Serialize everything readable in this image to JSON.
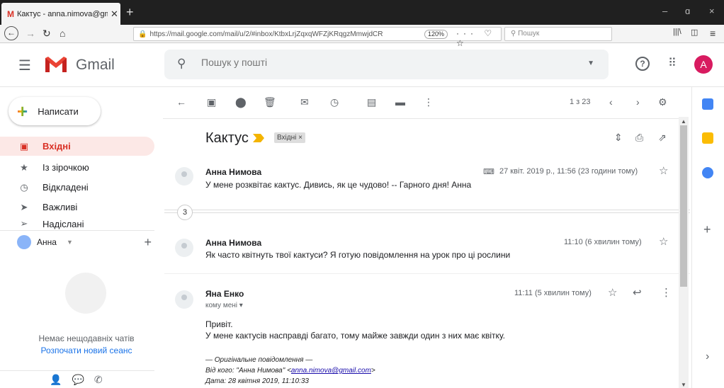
{
  "browser": {
    "tab_title": "Кактус - anna.nimova@gmail.",
    "tab_close": "✕",
    "new_tab": "+",
    "url": "https://mail.google.com/mail/u/2/#inbox/KtbxLrjZqxqWFZjKRqgzMmwjdCR",
    "zoom": "120%",
    "search_placeholder": "Пошук",
    "window_minimize": "–",
    "window_restore": "ɑ",
    "window_close": "×"
  },
  "header": {
    "app_name": "Gmail",
    "search_placeholder": "Пошук у пошті",
    "avatar_letter": "A",
    "help_label": "?"
  },
  "sidebar": {
    "compose_label": "Написати",
    "items": [
      {
        "label": "Вхідні",
        "icon": "inbox-icon"
      },
      {
        "label": "Із зірочкою",
        "icon": "star-icon"
      },
      {
        "label": "Відкладені",
        "icon": "clock-icon"
      },
      {
        "label": "Важливі",
        "icon": "important-icon"
      },
      {
        "label": "Надіслані",
        "icon": "sent-icon"
      }
    ],
    "hangouts_user": "Анна",
    "no_chats": "Немає нещодавніх чатів",
    "new_session": "Розпочати новий сеанс"
  },
  "toolbar": {
    "page_count": "1 з 23"
  },
  "thread": {
    "subject": "Кактус",
    "label": "Вхідні ×",
    "collapsed_count": "3",
    "messages": [
      {
        "sender": "Анна Нимова",
        "date": "27 квіт. 2019 р., 11:56 (23 години тому)",
        "snippet": "У мене розквітає кактус. Дивись, як це чудово! -- Гарного дня! Анна"
      },
      {
        "sender": "Анна Нимова",
        "date": "11:10 (6 хвилин тому)",
        "snippet": "Як часто квітнуть твої кактуси? Я готую повідомлення на урок про ці рослини"
      },
      {
        "sender": "Яна Енко",
        "date": "11:11 (5 хвилин тому)",
        "to": "кому мені",
        "body": [
          "Привіт.",
          "У мене кактусів насправді багато, тому майже завжди один з них має квітку."
        ],
        "quote_header": "— Оригінальне повідомлення —",
        "quote_from_label": "Від кого: \"Анна Нимова\" <",
        "quote_from_email": "anna.nimova@gmail.com",
        "quote_from_end": ">",
        "quote_date": "Дата: 28 квітня 2019, 11:10:33"
      }
    ]
  },
  "colors": {
    "accent": "#d93025",
    "link": "#1a73e8",
    "avatar": "#d81b60"
  }
}
